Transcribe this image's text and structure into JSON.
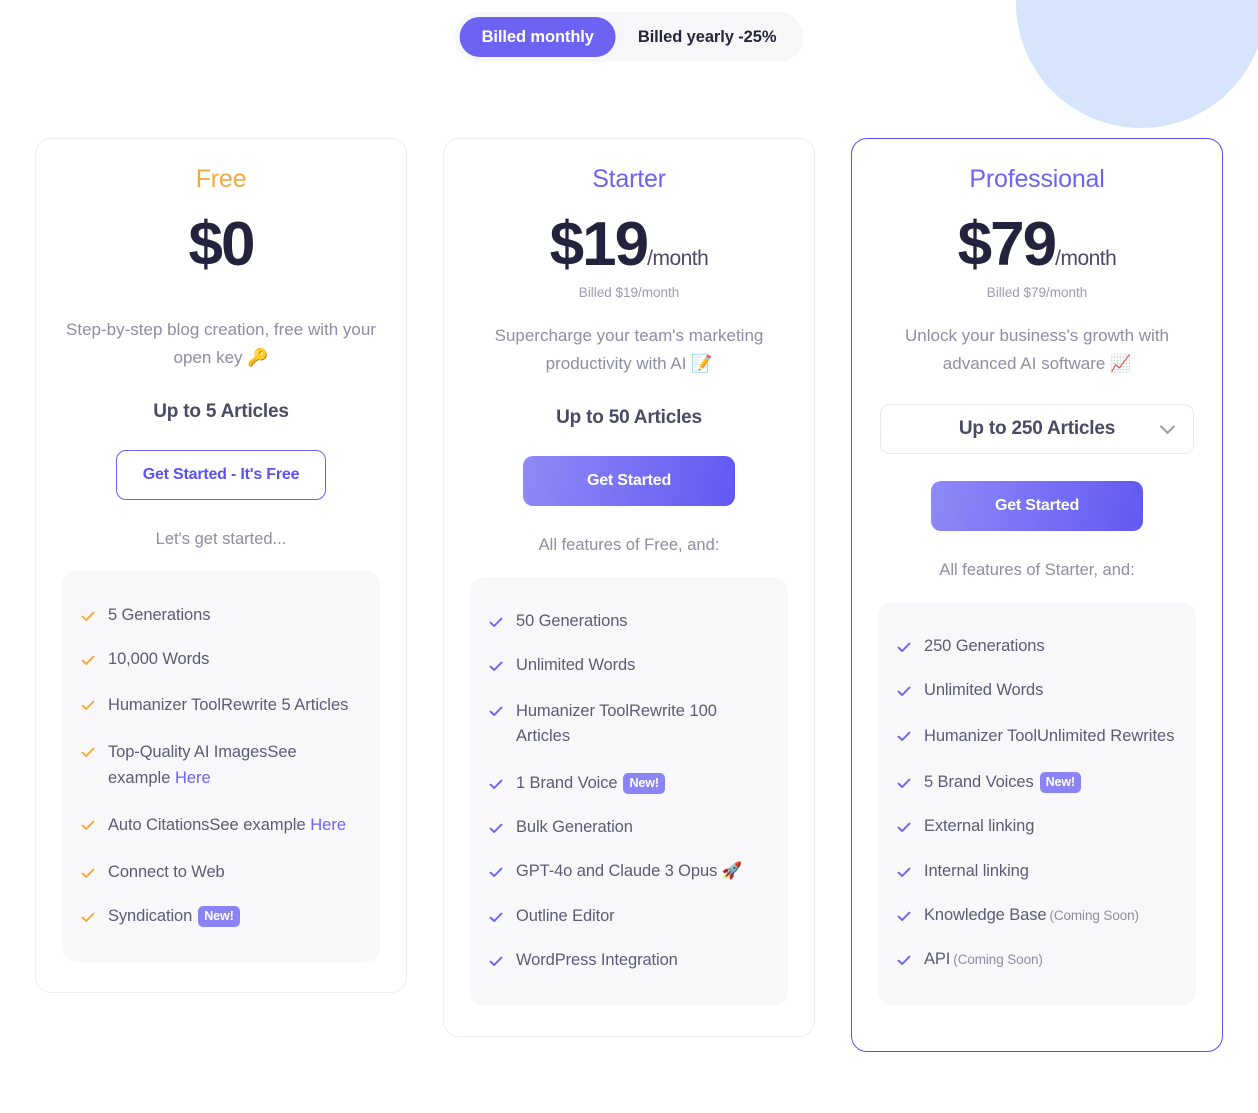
{
  "billing_toggle": {
    "options": [
      {
        "label": "Billed monthly",
        "active": true
      },
      {
        "label": "Billed yearly -25%",
        "active": false
      }
    ]
  },
  "colors": {
    "accent_indigo": "#6c63f5",
    "accent_orange": "#f5a93b",
    "price_dark": "#23233d",
    "panel_bg": "#f8f8fa",
    "deco_blue": "#d6e4fc"
  },
  "plans": [
    {
      "name": "Free",
      "price": "$0",
      "per": "",
      "billed_note": "",
      "tagline": "Step-by-step blog creation, free with your open key 🔑",
      "articles_label": "Up to 5 Articles",
      "has_select": false,
      "cta_label": "Get Started - It's Free",
      "cta_style": "ghost",
      "features_intro": "Let's get started...",
      "check_color": "#f5a93b",
      "features": [
        {
          "main": "5 Generations"
        },
        {
          "main": "10,000 Words"
        },
        {
          "main": "Humanizer Tool",
          "sub": "Rewrite 5 Articles"
        },
        {
          "main": "Top-Quality AI Images",
          "sub_prefix": "See example ",
          "sub_link": "Here"
        },
        {
          "main": "Auto Citations",
          "sub_prefix": "See example ",
          "sub_link": "Here"
        },
        {
          "main": "Connect to Web"
        },
        {
          "main": "Syndication",
          "badge": "New!"
        }
      ]
    },
    {
      "name": "Starter",
      "price": "$19",
      "per": "/month",
      "billed_note": "Billed $19/month",
      "tagline": "Supercharge your team's marketing productivity with AI 📝",
      "articles_label": "Up to 50 Articles",
      "has_select": false,
      "cta_label": "Get Started",
      "cta_style": "solid",
      "features_intro": "All features of Free, and:",
      "check_color": "#6c63f5",
      "features": [
        {
          "main": "50 Generations"
        },
        {
          "main": "Unlimited Words"
        },
        {
          "main": "Humanizer Tool",
          "sub": "Rewrite 100 Articles"
        },
        {
          "main": "1 Brand Voice",
          "badge": "New!"
        },
        {
          "main": "Bulk Generation"
        },
        {
          "main": "GPT-4o and Claude 3 Opus 🚀"
        },
        {
          "main": "Outline Editor"
        },
        {
          "main": "WordPress Integration"
        }
      ]
    },
    {
      "name": "Professional",
      "price": "$79",
      "per": "/month",
      "billed_note": "Billed $79/month",
      "tagline": "Unlock your business's growth with advanced AI software 📈",
      "articles_label": "Up to 250 Articles",
      "has_select": true,
      "cta_label": "Get Started",
      "cta_style": "solid",
      "features_intro": "All features of Starter, and:",
      "check_color": "#6c63f5",
      "featured": true,
      "features": [
        {
          "main": "250 Generations"
        },
        {
          "main": "Unlimited Words"
        },
        {
          "main": "Humanizer Tool",
          "sub": "Unlimited Rewrites"
        },
        {
          "main": "5 Brand Voices",
          "badge": "New!"
        },
        {
          "main": "External linking"
        },
        {
          "main": "Internal linking"
        },
        {
          "main": "Knowledge Base",
          "soon": "(Coming Soon)"
        },
        {
          "main": "API",
          "soon": "(Coming Soon)"
        }
      ]
    }
  ]
}
